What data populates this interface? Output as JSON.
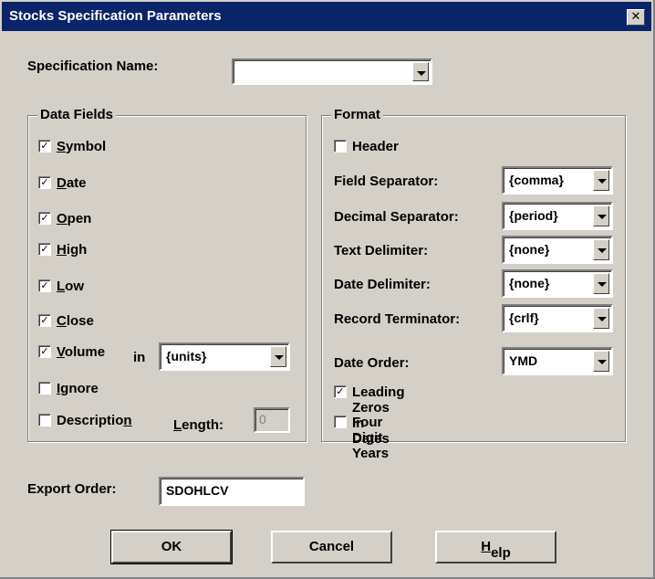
{
  "window": {
    "title": "Stocks Specification Parameters",
    "close_glyph": "✕"
  },
  "spec_name": {
    "label": "Specification Name:",
    "value": ""
  },
  "data_fields": {
    "title": "Data Fields",
    "items": [
      {
        "pre": "",
        "mn": "S",
        "post": "ymbol",
        "checked": true
      },
      {
        "pre": "",
        "mn": "D",
        "post": "ate",
        "checked": true
      },
      {
        "pre": "",
        "mn": "O",
        "post": "pen",
        "checked": true
      },
      {
        "pre": "",
        "mn": "H",
        "post": "igh",
        "checked": true
      },
      {
        "pre": "",
        "mn": "L",
        "post": "ow",
        "checked": true
      },
      {
        "pre": "",
        "mn": "C",
        "post": "lose",
        "checked": true
      },
      {
        "pre": "",
        "mn": "V",
        "post": "olume",
        "checked": true
      },
      {
        "pre": "",
        "mn": "I",
        "post": "gnore",
        "checked": false
      },
      {
        "pre": "Descriptio",
        "mn": "n",
        "post": "",
        "checked": false
      }
    ],
    "volume_in_label": "in",
    "volume_units": "{units}",
    "length_label_pre": "",
    "length_label_mn": "L",
    "length_label_post": "ength:",
    "length_value": "0"
  },
  "format": {
    "title": "Format",
    "header": {
      "label": "Header",
      "checked": false
    },
    "rows": [
      {
        "label": "Field Separator:",
        "value": "{comma}"
      },
      {
        "label": "Decimal Separator:",
        "value": "{period}"
      },
      {
        "label": "Text Delimiter:",
        "value": "{none}"
      },
      {
        "label": "Date Delimiter:",
        "value": "{none}"
      },
      {
        "label": "Record Terminator:",
        "value": "{crlf}"
      }
    ],
    "date_order": {
      "label": "Date Order:",
      "value": "YMD"
    },
    "leading_zeros": {
      "label": "Leading Zeros in Dates",
      "checked": true
    },
    "four_digit_years": {
      "label": "Four Digit Years",
      "checked": false
    }
  },
  "export_order": {
    "label": "Export Order:",
    "value": "SDOHLCV"
  },
  "buttons": {
    "ok": "OK",
    "cancel": "Cancel",
    "help_mn": "H",
    "help_post": "elp"
  },
  "check_glyph": "✓",
  "icons": {
    "close": "close-icon",
    "dropdown": "chevron-down-icon"
  }
}
